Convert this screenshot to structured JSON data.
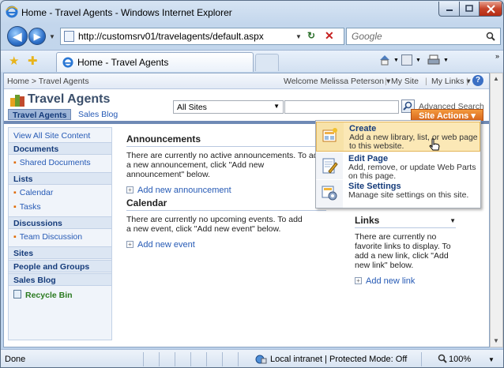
{
  "window": {
    "title": "Home - Travel Agents - Windows Internet Explorer"
  },
  "address_bar": {
    "url": "http://customsrv01/travelagents/default.aspx",
    "search_placeholder": "Google"
  },
  "browser_tab": {
    "title": "Home - Travel Agents"
  },
  "sharepoint": {
    "breadcrumb": "Home > Travel Agents",
    "welcome": "Welcome Melissa Peterson ▾",
    "my_site": "My Site",
    "my_links": "My Links ▾",
    "site_title": "Travel Agents",
    "search_scope": "All Sites",
    "advanced_search": "Advanced Search",
    "tabs": [
      "Travel Agents",
      "Sales Blog"
    ],
    "site_actions": "Site Actions ▾"
  },
  "quick_launch": {
    "view_all": "View All Site Content",
    "documents": "Documents",
    "shared_documents": "Shared Documents",
    "lists": "Lists",
    "calendar": "Calendar",
    "tasks": "Tasks",
    "discussions": "Discussions",
    "team_discussion": "Team Discussion",
    "sites": "Sites",
    "people_groups": "People and Groups",
    "sales_blog": "Sales Blog",
    "recycle_bin": "Recycle Bin"
  },
  "announcements": {
    "title": "Announcements",
    "text": "There are currently no active announcements. To add a new announcement, click \"Add new announcement\" below.",
    "add": "Add new announcement"
  },
  "calendar": {
    "title": "Calendar",
    "text": "There are currently no upcoming events. To add a new event, click \"Add new event\" below.",
    "add": "Add new event"
  },
  "links": {
    "title": "Links",
    "text": "There are currently no favorite links to display. To add a new link, click \"Add new link\" below.",
    "add": "Add new link"
  },
  "site_actions_menu": [
    {
      "title": "Create",
      "desc": "Add a new library, list, or web page to this website."
    },
    {
      "title": "Edit Page",
      "desc": "Add, remove, or update Web Parts on this page."
    },
    {
      "title": "Site Settings",
      "desc": "Manage site settings on this site."
    }
  ],
  "status_bar": {
    "status": "Done",
    "zone": "Local intranet | Protected Mode: Off",
    "zoom": "100%"
  }
}
